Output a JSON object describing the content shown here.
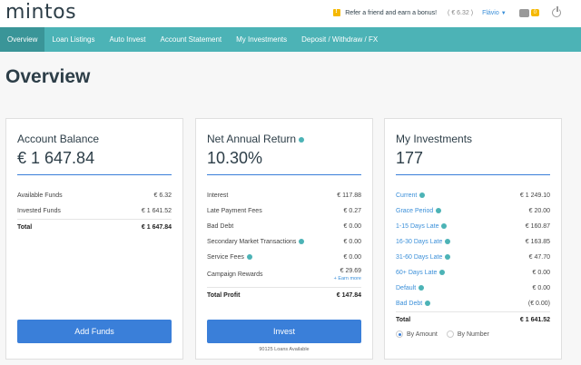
{
  "header": {
    "logo": "mintos",
    "bonus_link": "Refer a friend and earn a bonus!",
    "balance": "( € 6.32 )",
    "user": "Flávio",
    "cart_count": "0"
  },
  "nav": {
    "items": [
      "Overview",
      "Loan Listings",
      "Auto Invest",
      "Account Statement",
      "My Investments",
      "Deposit / Withdraw / FX"
    ]
  },
  "page_title": "Overview",
  "account_balance": {
    "title": "Account Balance",
    "value": "€ 1 647.84",
    "rows": [
      {
        "label": "Available Funds",
        "value": "€ 6.32"
      },
      {
        "label": "Invested Funds",
        "value": "€ 1 641.52"
      }
    ],
    "total_label": "Total",
    "total_value": "€ 1 647.84",
    "button": "Add Funds"
  },
  "net_return": {
    "title": "Net Annual Return",
    "value": "10.30%",
    "rows": [
      {
        "label": "Interest",
        "value": "€ 117.88"
      },
      {
        "label": "Late Payment Fees",
        "value": "€ 0.27"
      },
      {
        "label": "Bad Debt",
        "value": "€ 0.00"
      },
      {
        "label": "Secondary Market Transactions",
        "value": "€ 0.00"
      },
      {
        "label": "Service Fees",
        "value": "€ 0.00"
      }
    ],
    "campaign_label": "Campaign Rewards",
    "campaign_value": "€ 29.69",
    "learn_more": "+ Earn more",
    "total_label": "Total Profit",
    "total_value": "€ 147.84",
    "button": "Invest",
    "loans_available": "90125 Loans Available"
  },
  "my_investments": {
    "title": "My Investments",
    "value": "177",
    "rows": [
      {
        "label": "Current",
        "value": "€ 1 249.10"
      },
      {
        "label": "Grace Period",
        "value": "€ 20.00"
      },
      {
        "label": "1-15 Days Late",
        "value": "€ 160.87"
      },
      {
        "label": "16-30 Days Late",
        "value": "€ 163.85"
      },
      {
        "label": "31-60 Days Late",
        "value": "€ 47.70"
      },
      {
        "label": "60+ Days Late",
        "value": "€ 0.00"
      },
      {
        "label": "Default",
        "value": "€ 0.00"
      },
      {
        "label": "Bad Debt",
        "value": "(€ 0.00)"
      }
    ],
    "total_label": "Total",
    "total_value": "€ 1 641.52",
    "radio_amount": "By Amount",
    "radio_number": "By Number"
  }
}
